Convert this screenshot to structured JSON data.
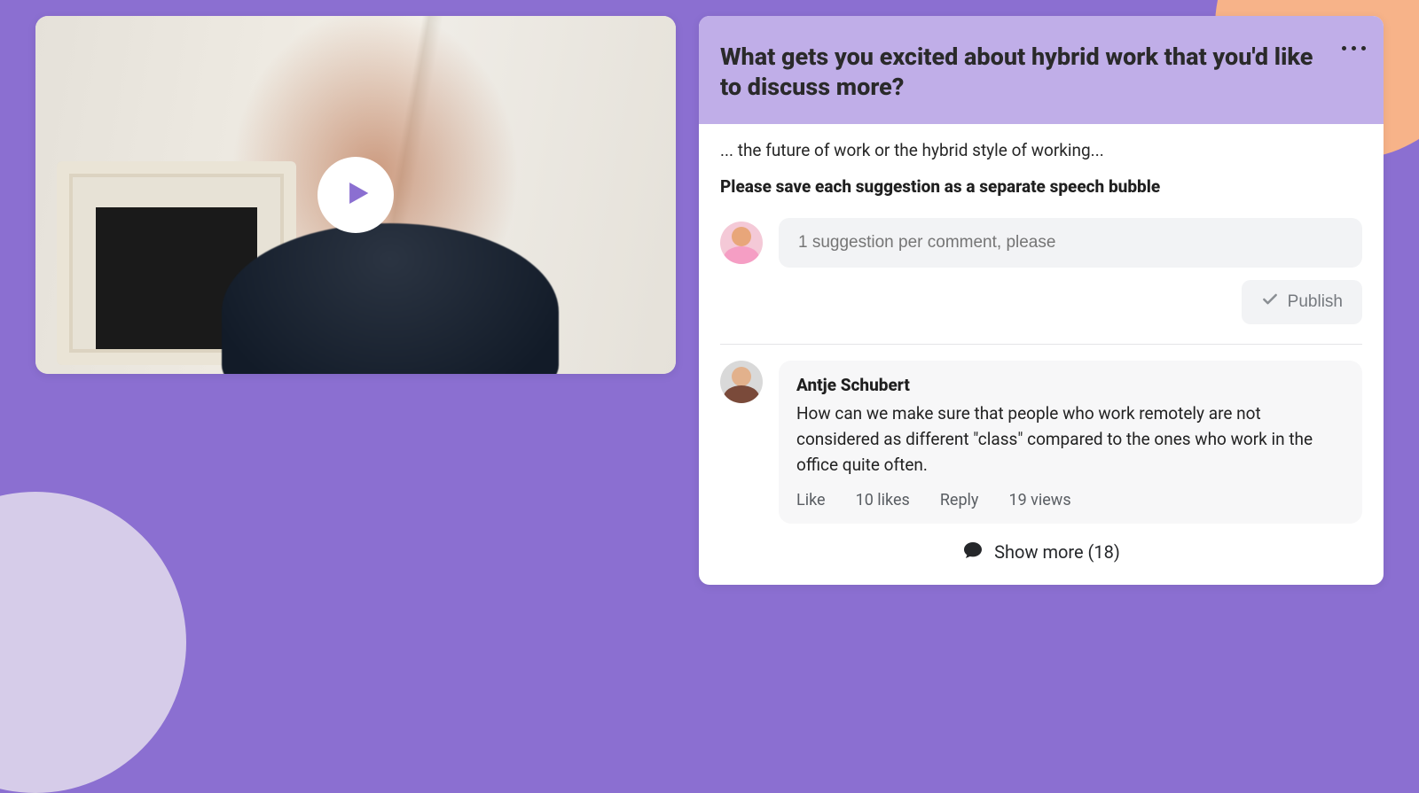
{
  "question": {
    "title": "What gets you excited about hybrid work that you'd like to discuss more?",
    "excerpt": "... the future of work or the hybrid style of working...",
    "instruction": "Please save each suggestion as a separate speech bubble"
  },
  "compose": {
    "placeholder": "1 suggestion per comment, please",
    "publish_label": "Publish"
  },
  "comment": {
    "author": "Antje Schubert",
    "text": "How can we make sure that people who work remotely are not considered as different \"class\" compared to the ones who work in the office quite often.",
    "like_label": "Like",
    "likes": "10 likes",
    "reply_label": "Reply",
    "views": "19 views"
  },
  "show_more": {
    "label": "Show more (18)"
  }
}
